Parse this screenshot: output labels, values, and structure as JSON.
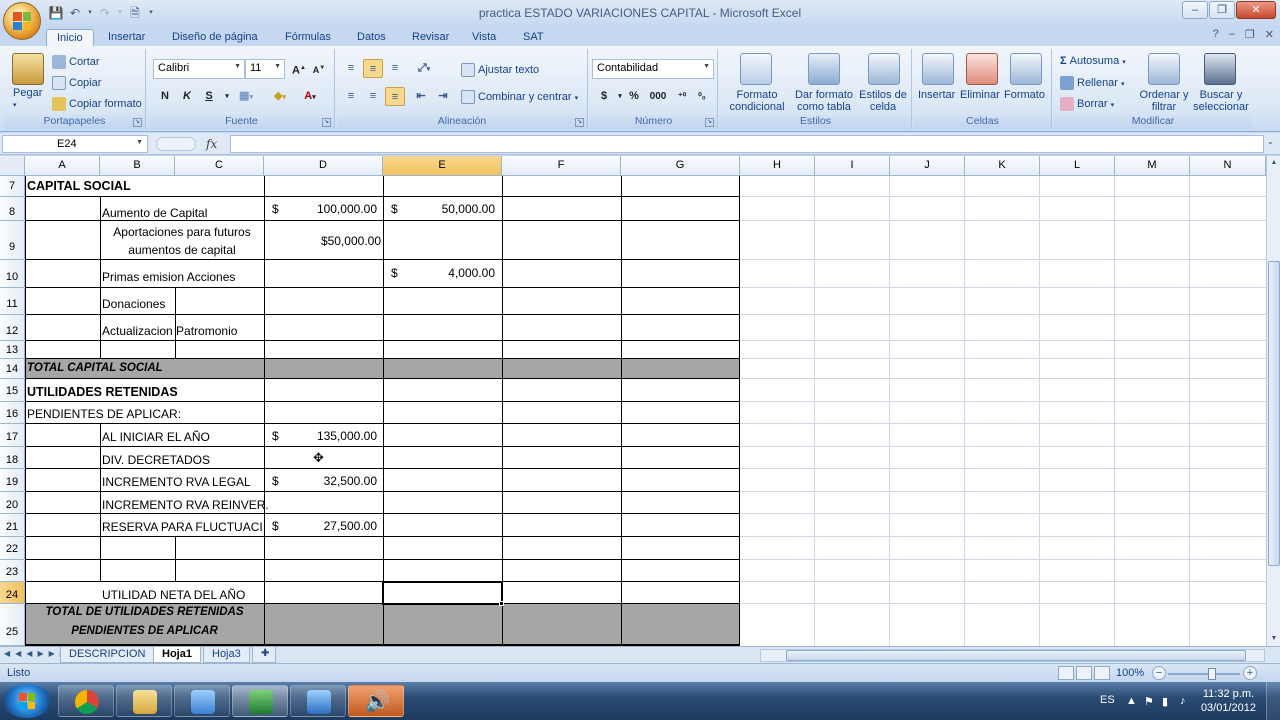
{
  "app": {
    "title": "practica ESTADO VARIACIONES CAPITAL - Microsoft Excel",
    "help": "?"
  },
  "ribbon_tabs": [
    "Inicio",
    "Insertar",
    "Diseño de página",
    "Fórmulas",
    "Datos",
    "Revisar",
    "Vista",
    "SAT"
  ],
  "ribbon": {
    "clipboard": {
      "paste": "Pegar",
      "cut": "Cortar",
      "copy": "Copiar",
      "format_painter": "Copiar formato",
      "label": "Portapapeles"
    },
    "font": {
      "name": "Calibri",
      "size": "11",
      "bold": "N",
      "italic": "K",
      "underline": "S",
      "label": "Fuente"
    },
    "alignment": {
      "wrap": "Ajustar texto",
      "merge": "Combinar y centrar",
      "label": "Alineación"
    },
    "number": {
      "format": "Contabilidad",
      "currency": "$",
      "percent": "%",
      "thousands": "000",
      "label": "Número"
    },
    "styles": {
      "conditional": "Formato condicional",
      "table": "Dar formato como tabla",
      "cell_styles": "Estilos de celda",
      "label": "Estilos"
    },
    "cells": {
      "insert": "Insertar",
      "delete": "Eliminar",
      "format": "Formato",
      "label": "Celdas"
    },
    "editing": {
      "autosum": "Autosuma",
      "fill": "Rellenar",
      "clear": "Borrar",
      "sort": "Ordenar y filtrar",
      "find": "Buscar y seleccionar",
      "label": "Modificar"
    }
  },
  "formula_bar": {
    "name_box": "E24",
    "fx": "fx",
    "formula": ""
  },
  "columns": [
    "A",
    "B",
    "C",
    "D",
    "E",
    "F",
    "G",
    "H",
    "I",
    "J",
    "K",
    "L",
    "M",
    "N"
  ],
  "rows": [
    "7",
    "8",
    "9",
    "10",
    "11",
    "12",
    "13",
    "14",
    "15",
    "16",
    "17",
    "18",
    "19",
    "20",
    "21",
    "22",
    "23",
    "24",
    "25"
  ],
  "cells": {
    "r7_a": "CAPITAL SOCIAL",
    "r8_b": "Aumento de Capital",
    "r8_d_cur": "$",
    "r8_d": "100,000.00",
    "r8_e_cur": "$",
    "r8_e": "50,000.00",
    "r9_b1": "Aportaciones para futuros",
    "r9_b2": "aumentos de capital",
    "r9_d": "$50,000.00",
    "r10_b": "Primas emision Acciones",
    "r10_e_cur": "$",
    "r10_e": "4,000.00",
    "r11_b": "Donaciones",
    "r12_b": "Actualizacion Patromonio",
    "r14_a": "TOTAL CAPITAL SOCIAL",
    "r15_a": "UTILIDADES RETENIDAS",
    "r16_a": "PENDIENTES DE APLICAR:",
    "r17_b": "AL INICIAR EL AÑO",
    "r17_d_cur": "$",
    "r17_d": "135,000.00",
    "r18_b": "DIV. DECRETADOS",
    "r19_b": "INCREMENTO RVA LEGAL",
    "r19_d_cur": "$",
    "r19_d": "32,500.00",
    "r20_b": "INCREMENTO RVA REINVER.",
    "r21_b": "RESERVA PARA FLUCTUACIO",
    "r21_d_cur": "$",
    "r21_d": "27,500.00",
    "r24_b": "UTILIDAD NETA DEL AÑO",
    "r25_a1": "TOTAL DE UTILIDADES RETENIDAS",
    "r25_a2": "PENDIENTES DE APLICAR"
  },
  "sheets": [
    "DESCRIPCION",
    "Hoja1",
    "Hoja3"
  ],
  "active_sheet": "Hoja1",
  "status": {
    "mode": "Listo",
    "zoom": "100%"
  },
  "taskbar": {
    "language": "ES",
    "time": "11:32 p.m.",
    "date": "03/01/2012"
  },
  "colors": {
    "accent": "#f1c15f",
    "total_fill": "#a6a6a6",
    "ribbon": "#dce8f6"
  }
}
